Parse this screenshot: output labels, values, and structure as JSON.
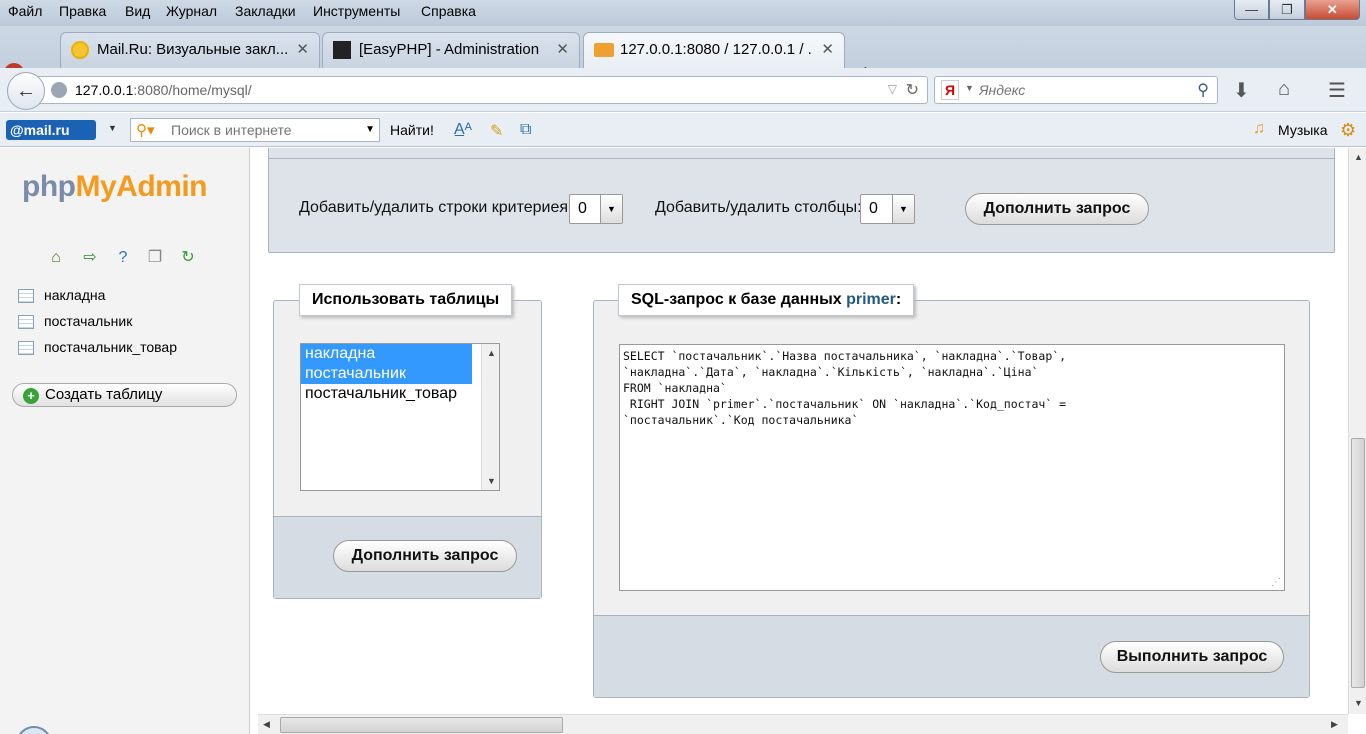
{
  "menu": [
    "Файл",
    "Правка",
    "Вид",
    "Журнал",
    "Закладки",
    "Инструменты",
    "Справка"
  ],
  "window_controls": {
    "minimize": "—",
    "maximize": "❐",
    "close": "✕"
  },
  "tabs": [
    {
      "title": "Mail.Ru: Визуальные закл...",
      "active": false
    },
    {
      "title": "[EasyPHP] - Administration",
      "active": false
    },
    {
      "title": "127.0.0.1:8080 / 127.0.0.1 / ...",
      "active": true
    }
  ],
  "tab_close": "✕",
  "new_tab": "+",
  "url": {
    "host": "127.0.0.1",
    "rest": ":8080/home/mysql/"
  },
  "search": {
    "engine_badge": "Я",
    "placeholder": "Яндекс"
  },
  "bookmarks": {
    "mailru_logo": "@mail.ru",
    "search_placeholder": "Поиск в интернете",
    "find_label": "Найти!",
    "music_label": "Музыка"
  },
  "sidebar": {
    "logo_php": "php",
    "logo_myadmin": "MyAdmin",
    "tables": [
      "накладна",
      "постачальник",
      "постачальник_товар"
    ],
    "create_table": "Создать таблицу"
  },
  "criteria": {
    "rows_label": "Добавить/удалить строки критериея:",
    "rows_value": "0",
    "cols_label": "Добавить/удалить столбцы:",
    "cols_value": "0",
    "update_button": "Дополнить запрос"
  },
  "use_tables": {
    "legend": "Использовать таблицы",
    "options": [
      {
        "label": "накладна",
        "selected": true
      },
      {
        "label": "постачальник",
        "selected": true
      },
      {
        "label": "постачальник_товар",
        "selected": false
      }
    ],
    "update_button": "Дополнить запрос"
  },
  "sql_query": {
    "legend_prefix": "SQL-запрос к базе данных ",
    "db_name": "primer",
    "legend_suffix": ":",
    "text": "SELECT `постачальник`.`Назва постачальника`, `накладна`.`Товар`,\n`накладна`.`Дата`, `накладна`.`Кількість`, `накладна`.`Ціна`\nFROM `накладна`\n RIGHT JOIN `primer`.`постачальник` ON `накладна`.`Код_постач` =\n`постачальник`.`Код постачальника`",
    "submit_button": "Выполнить запрос"
  },
  "colors": {
    "accent_db": "#235a81",
    "logo_orange": "#f49a1c",
    "logo_gray": "#7a8ca8",
    "selection": "#3399ff"
  }
}
